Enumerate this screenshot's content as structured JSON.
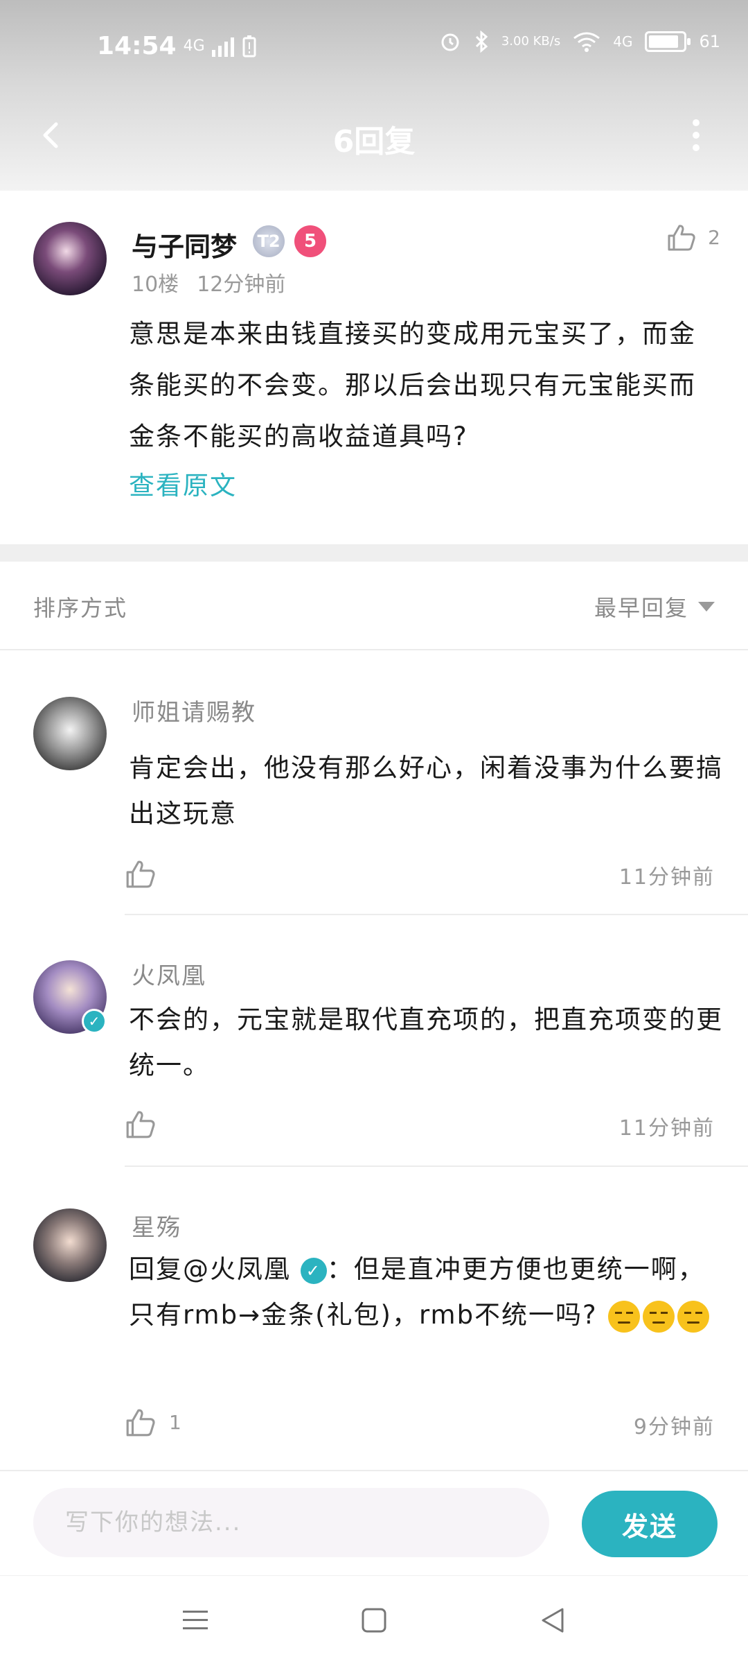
{
  "status_bar": {
    "time": "14:54",
    "signal_left": "4G",
    "net_speed": "3.00 KB/s",
    "net_type": "4G",
    "battery": "61"
  },
  "header": {
    "title": "6回复"
  },
  "post": {
    "author": "与子同梦",
    "badge_t": "T2",
    "badge_level": "5",
    "floor": "10楼",
    "time": "12分钟前",
    "likes": "2",
    "body": "意思是本来由钱直接买的变成用元宝买了，而金条能买的不会变。那以后会出现只有元宝能买而金条不能买的高收益道具吗?",
    "view_original": "查看原文"
  },
  "sort": {
    "label": "排序方式",
    "selected": "最早回复"
  },
  "replies": [
    {
      "author": "师姐请赐教",
      "body": "肯定会出，他没有那么好心，闲着没事为什么要搞出这玩意",
      "likes": "",
      "time": "11分钟前"
    },
    {
      "author": "火凤凰",
      "body": "不会的，元宝就是取代直充项的，把直充项变的更统一。",
      "likes": "",
      "time": "11分钟前"
    },
    {
      "author": "星殇",
      "reply_prefix": "回复",
      "mention": "@火凤凰",
      "body": "：但是直冲更方便也更统一啊，只有rmb→金条(礼包)，rmb不统一吗?",
      "likes": "1",
      "time": "9分钟前"
    }
  ],
  "input": {
    "placeholder": "写下你的想法...",
    "send_label": "发送"
  },
  "colors": {
    "accent": "#2bb3c0",
    "level_badge": "#f0507a",
    "muted_text": "#999999"
  },
  "icons": {
    "back": "back-arrow-icon",
    "more": "more-vertical-icon",
    "like": "thumbs-up-icon",
    "sort": "triangle-down-icon",
    "verified": "verified-check-icon",
    "emoji": "unamused-face-emoji",
    "nav_menu": "menu-lines-icon",
    "nav_home": "square-home-icon",
    "nav_back": "triangle-back-icon"
  }
}
